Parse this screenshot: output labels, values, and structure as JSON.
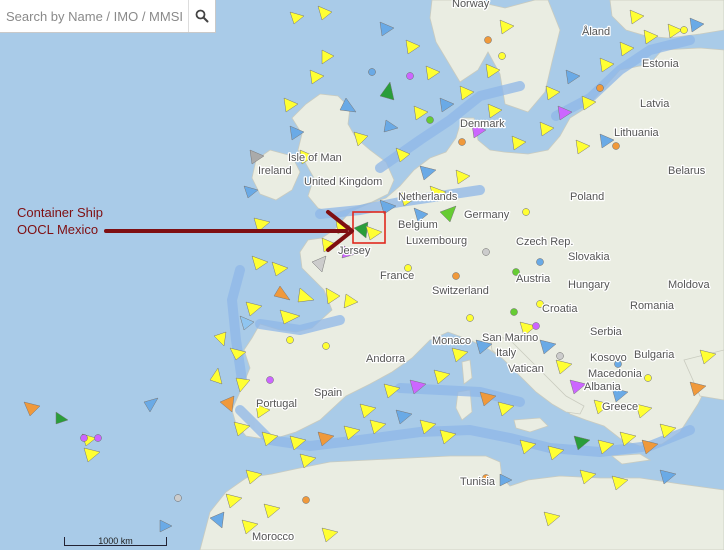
{
  "search": {
    "placeholder": "Search by Name / IMO / MMSI"
  },
  "icons": {
    "search": "search-icon",
    "arrow": "annotation-arrow",
    "marker": "highlight-box"
  },
  "colors": {
    "sea": "#a9cbe8",
    "land": "#eaede2",
    "shipping_lane": "#8fb7e8",
    "annotation": "#7f0f12",
    "highlight": "#e0281e"
  },
  "annotation": {
    "line1": "Container Ship",
    "line2": "OOCL Mexico"
  },
  "scale_bar": {
    "label": "1000 km"
  },
  "labels": {
    "norway": "Norway",
    "aland": "Åland",
    "estonia": "Estonia",
    "latvia": "Latvia",
    "lithuania": "Lithuania",
    "denmark": "Denmark",
    "belarus": "Belarus",
    "isle_of_man": "Isle of Man",
    "ireland": "Ireland",
    "uk": "United Kingdom",
    "netherlands": "Netherlands",
    "poland": "Poland",
    "germany": "Germany",
    "belgium": "Belgium",
    "luxembourg": "Luxembourg",
    "czech": "Czech Rep.",
    "slovakia": "Slovakia",
    "jersey": "Jersey",
    "austria": "Austria",
    "hungary": "Hungary",
    "france": "France",
    "switzerland": "Switzerland",
    "moldova": "Moldova",
    "croatia": "Croatia",
    "romania": "Romania",
    "serbia": "Serbia",
    "monaco": "Monaco",
    "san_marino": "San Marino",
    "andorra": "Andorra",
    "italy": "Italy",
    "kosovo": "Kosovo",
    "bulgaria": "Bulgaria",
    "vatican": "Vatican",
    "macedonia": "Macedonia",
    "albania": "Albania",
    "spain": "Spain",
    "portugal": "Portugal",
    "greece": "Greece",
    "tunisia": "Tunisia",
    "morocco": "Morocco"
  }
}
